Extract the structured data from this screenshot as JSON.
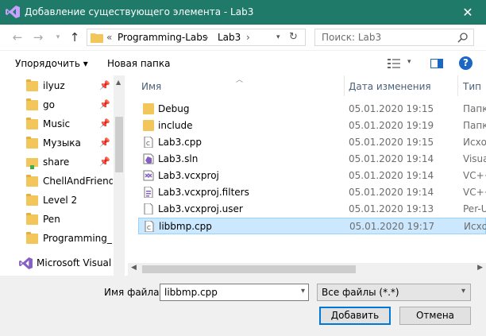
{
  "window": {
    "title": "Добавление существующего элемента - Lab3",
    "close_label": "✕"
  },
  "nav": {
    "breadcrumb": {
      "overflow": "«",
      "items": [
        "Programming-Labs",
        "Lab3"
      ],
      "separator": "›"
    },
    "search": {
      "placeholder": "Поиск: Lab3"
    }
  },
  "toolbar": {
    "organize_label": "Упорядочить ▾",
    "new_folder_label": "Новая папка",
    "help_label": "?"
  },
  "sidebar": {
    "items": [
      {
        "label": "ilyuz",
        "pinned": true
      },
      {
        "label": "go",
        "pinned": true
      },
      {
        "label": "Music",
        "pinned": true
      },
      {
        "label": "Музыка",
        "pinned": true
      },
      {
        "label": "share",
        "pinned": true
      },
      {
        "label": "ChellAndFriends",
        "pinned": false
      },
      {
        "label": "Level 2",
        "pinned": false
      },
      {
        "label": "Pen",
        "pinned": false
      },
      {
        "label": "Programming_L",
        "pinned": false
      },
      {
        "label": "Microsoft Visual S",
        "pinned": false
      }
    ]
  },
  "files": {
    "columns": {
      "name": "Имя",
      "date": "Дата изменения",
      "type": "Тип"
    },
    "rows": [
      {
        "name": "Debug",
        "date": "05.01.2020 19:15",
        "type": "Папк",
        "icon": "folder-icon",
        "selected": false
      },
      {
        "name": "include",
        "date": "05.01.2020 19:19",
        "type": "Папк",
        "icon": "folder-icon",
        "selected": false
      },
      {
        "name": "Lab3.cpp",
        "date": "05.01.2020 19:15",
        "type": "Исхо",
        "icon": "cpp-file-icon",
        "selected": false
      },
      {
        "name": "Lab3.sln",
        "date": "05.01.2020 19:14",
        "type": "Visua",
        "icon": "solution-file-icon",
        "selected": false
      },
      {
        "name": "Lab3.vcxproj",
        "date": "05.01.2020 19:14",
        "type": "VC++",
        "icon": "project-file-icon",
        "selected": false
      },
      {
        "name": "Lab3.vcxproj.filters",
        "date": "05.01.2020 19:14",
        "type": "VC++",
        "icon": "filters-file-icon",
        "selected": false
      },
      {
        "name": "Lab3.vcxproj.user",
        "date": "05.01.2020 19:13",
        "type": "Per-U",
        "icon": "user-file-icon",
        "selected": false
      },
      {
        "name": "libbmp.cpp",
        "date": "05.01.2020 19:17",
        "type": "Исхо",
        "icon": "cpp-file-icon",
        "selected": true
      }
    ]
  },
  "footer": {
    "filename_label": "Имя файла:",
    "filename_value": "libbmp.cpp",
    "filter_value": "Все файлы (*.*)",
    "add_label": "Добавить",
    "cancel_label": "Отмена"
  },
  "colors": {
    "titlebar": "#1f7a6a",
    "selection": "#cce8ff",
    "accent": "#0078d7",
    "folder": "#f3c65c"
  }
}
